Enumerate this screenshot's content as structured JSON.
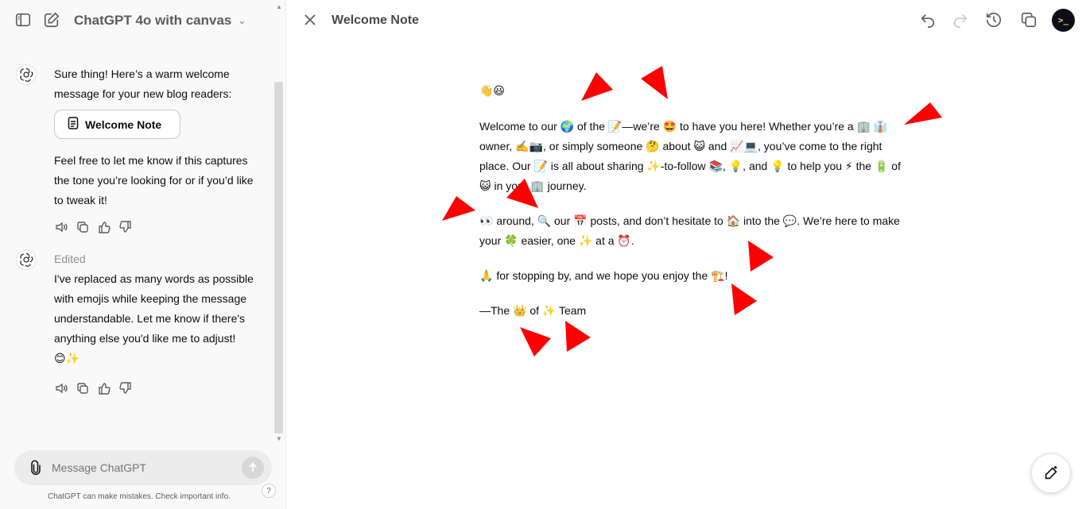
{
  "header": {
    "model_title": "ChatGPT 4o with canvas"
  },
  "chat": {
    "message1": {
      "intro": "Sure thing! Here’s a warm welcome message for your new blog readers:",
      "doc_button_label": "Welcome Note",
      "followup": "Feel free to let me know if this captures the tone you’re looking for or if you’d like to tweak it!"
    },
    "message2": {
      "edited_label": "Edited",
      "text": "I've replaced as many words as possible with emojis while keeping the message understandable. Let me know if there's anything else you'd like me to adjust!",
      "emojis": "😊✨"
    }
  },
  "composer": {
    "placeholder": "Message ChatGPT",
    "disclaimer": "ChatGPT can make mistakes. Check important info.",
    "help_label": "?"
  },
  "canvas": {
    "title": "Welcome Note",
    "user_avatar_text": ">_",
    "paragraphs": [
      "👋😃",
      "Welcome to our 🌍 of the 📝—we’re 🤩 to have you here! Whether you’re a 🏢 👔 owner, ✍️📷, or simply someone 🤔 about 😺 and 📈💻, you’ve come to the right place. Our 📝 is all about sharing ✨-to-follow 📚, 💡, and 💡 to help you ⚡ the 🔋 of 😺 in your 🏢 journey.",
      "👀 around, 🔍 our 📅 posts, and don’t hesitate to 🏠 into the 💬. We’re here to make your 🍀 easier, one ✨ at a ⏰.",
      "🙏 for stopping by, and we hope you enjoy the 🏗️!",
      "—The 👑 of ✨ Team"
    ]
  },
  "colors": {
    "accent_arrow": "#ff0000",
    "sidebar_bg": "#f9f9f9",
    "canvas_bg": "#ffffff"
  }
}
